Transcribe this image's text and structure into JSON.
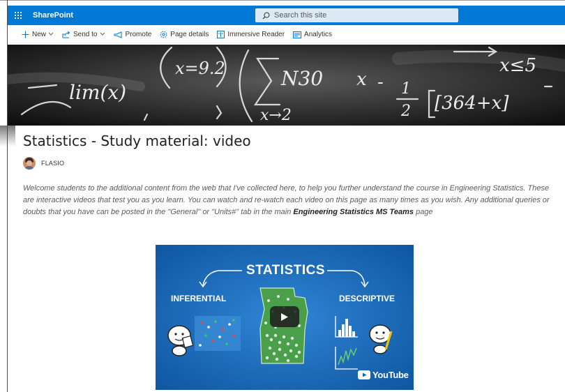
{
  "suite_bar": {
    "app_name": "SharePoint",
    "search_placeholder": "Search this site",
    "color": "#0078d4"
  },
  "command_bar": {
    "items": [
      {
        "label": "New",
        "icon": "plus-icon",
        "has_dropdown": true
      },
      {
        "label": "Send to",
        "icon": "share-icon",
        "has_dropdown": true
      },
      {
        "label": "Promote",
        "icon": "megaphone-icon",
        "has_dropdown": false
      },
      {
        "label": "Page details",
        "icon": "gear-icon",
        "has_dropdown": false
      },
      {
        "label": "Immersive Reader",
        "icon": "immersive-reader-icon",
        "has_dropdown": false
      },
      {
        "label": "Analytics",
        "icon": "analytics-icon",
        "has_dropdown": false
      }
    ]
  },
  "banner": {
    "handwriting": [
      "x=9.2",
      "lim(x)",
      "N30",
      "x",
      "-",
      "1",
      "2",
      "[364+x]",
      "x≤5",
      "x→2"
    ]
  },
  "page": {
    "title": "Statistics - Study material: video",
    "author": "FLASIO",
    "intro_text": "Welcome students to the additional content from the web that I've collected here, to help you further understand the course in Engineering Statistics. These are interactive videos that test you as you learn. You can watch and re-watch each video on this page as many times as you wish. Any additional queries or doubts that you have can be posted in the \"General\" or \"Units#\" tab in the main ",
    "intro_bold": "Engineering Statistics MS Teams",
    "intro_tail": " page"
  },
  "video": {
    "title": "STATISTICS",
    "left_label": "INFERENTIAL",
    "right_label": "DESCRIPTIVE",
    "platform": "YouTube",
    "background": "#1867b4"
  }
}
